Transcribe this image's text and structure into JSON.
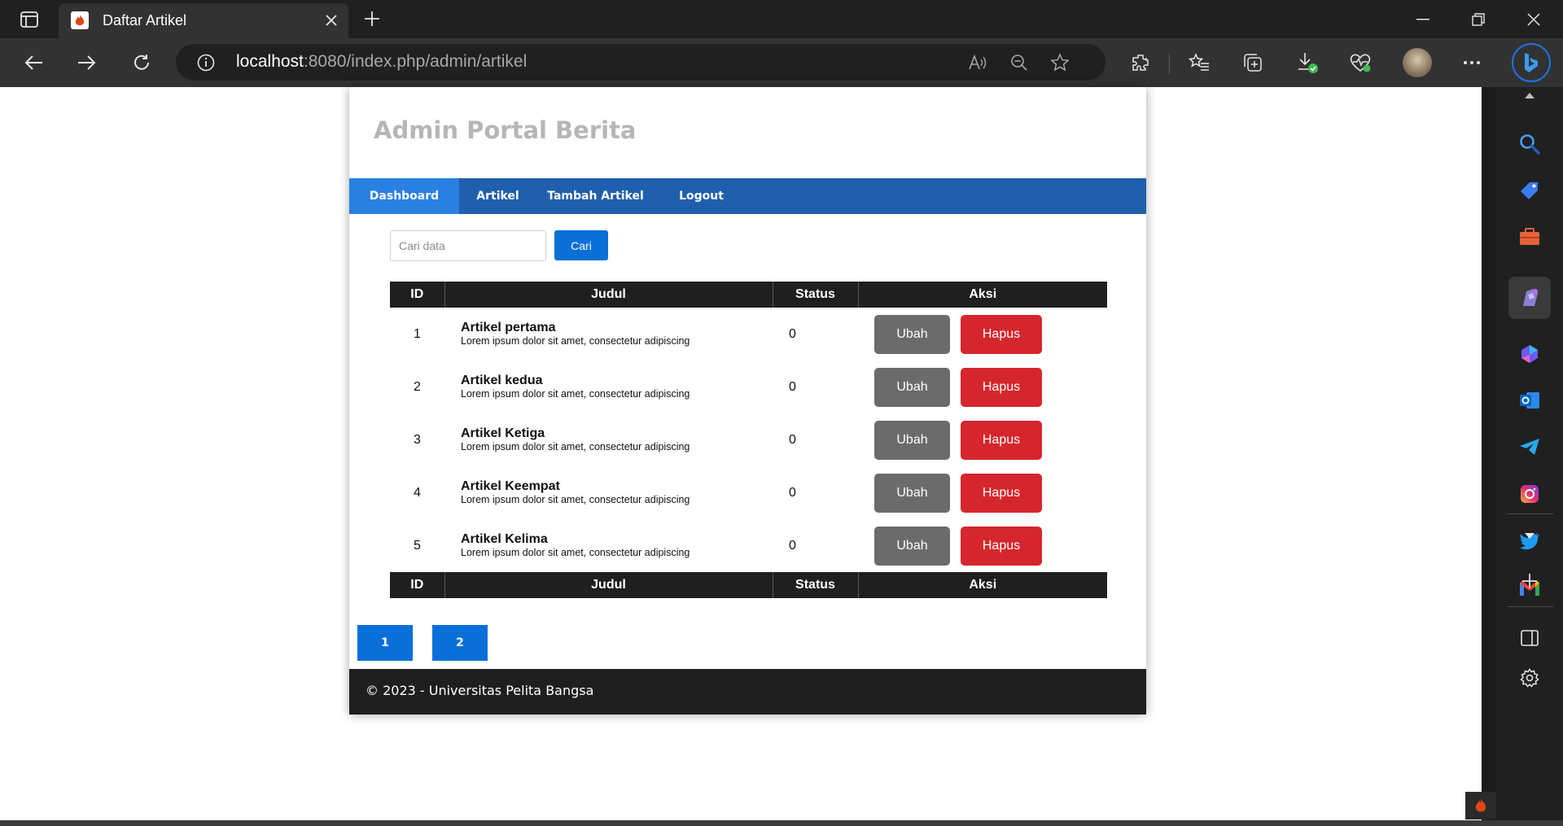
{
  "browser": {
    "tab_title": "Daftar Artikel",
    "url_host": "localhost",
    "url_rest": ":8080/index.php/admin/artikel"
  },
  "page": {
    "site_title": "Admin Portal Berita",
    "nav": [
      {
        "label": "Dashboard",
        "active": true
      },
      {
        "label": "Artikel"
      },
      {
        "label": "Tambah Artikel"
      },
      {
        "label": "Logout"
      }
    ],
    "search": {
      "placeholder": "Cari data",
      "button_label": "Cari"
    },
    "table": {
      "headers": [
        "ID",
        "Judul",
        "Status",
        "Aksi"
      ],
      "rows": [
        {
          "id": "1",
          "title": "Artikel pertama",
          "body": "Lorem ipsum dolor sit amet, consectetur adipiscing",
          "status": "0"
        },
        {
          "id": "2",
          "title": "Artikel kedua",
          "body": "Lorem ipsum dolor sit amet, consectetur adipiscing",
          "status": "0"
        },
        {
          "id": "3",
          "title": "Artikel Ketiga",
          "body": "Lorem ipsum dolor sit amet, consectetur adipiscing",
          "status": "0"
        },
        {
          "id": "4",
          "title": "Artikel Keempat",
          "body": "Lorem ipsum dolor sit amet, consectetur adipiscing",
          "status": "0"
        },
        {
          "id": "5",
          "title": "Artikel Kelima",
          "body": "Lorem ipsum dolor sit amet, consectetur adipiscing",
          "status": "0"
        }
      ],
      "edit_label": "Ubah",
      "delete_label": "Hapus"
    },
    "pagination": [
      "1",
      "2"
    ],
    "footer": "© 2023 - Universitas Pelita Bangsa"
  },
  "colors": {
    "nav_bg": "#1f5fad",
    "nav_active": "#2a80e2",
    "primary_button": "#0b6fd9",
    "edit_button": "#6b6b6b",
    "delete_button": "#d5262d",
    "table_header": "#1f1f1f"
  },
  "icons": {
    "sidebar": [
      "search-icon",
      "shopping-tag-icon",
      "tools-icon",
      "games-icon",
      "copilot-icon",
      "outlook-icon",
      "telegram-icon",
      "instagram-icon",
      "twitter-icon",
      "gmail-icon"
    ]
  }
}
